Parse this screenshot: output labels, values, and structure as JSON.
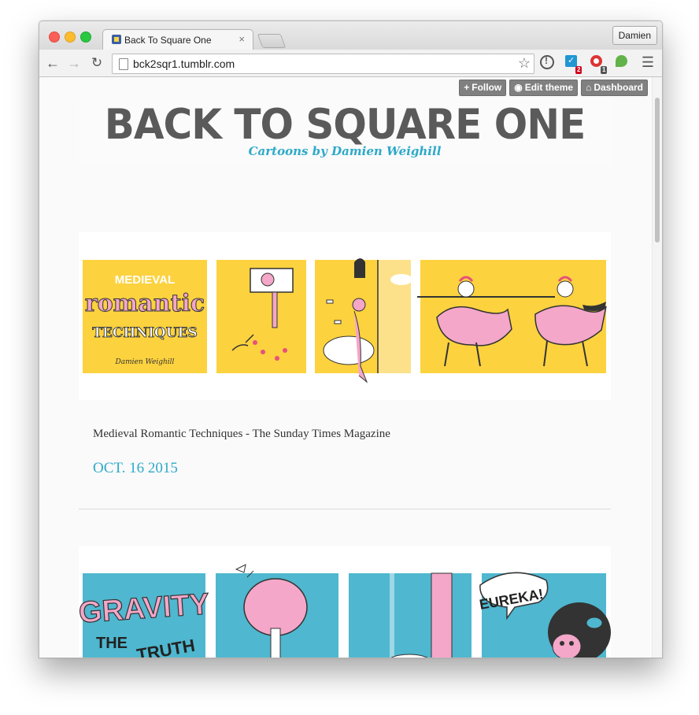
{
  "browser": {
    "tab_title": "Back To Square One",
    "tab_close": "×",
    "profile_name": "Damien",
    "url": "bck2sqr1.tumblr.com",
    "nav": {
      "back": "←",
      "forward": "→",
      "reload": "↻"
    },
    "star_icon": "☆",
    "menu_icon": "☰",
    "extensions": [
      {
        "name": "onepassword-icon"
      },
      {
        "name": "todo-icon",
        "badge": "2"
      },
      {
        "name": "adblock-icon",
        "badge": "1"
      },
      {
        "name": "evernote-icon"
      }
    ]
  },
  "tumblr_controls": {
    "follow": "Follow",
    "follow_icon": "+",
    "edit_theme": "Edit theme",
    "edit_icon": "◉",
    "dashboard": "Dashboard",
    "dashboard_icon": "⌂"
  },
  "blog": {
    "title": "BACK TO SQUARE ONE",
    "subtitle": "Cartoons by Damien Weighill"
  },
  "posts": [
    {
      "panels": [
        {
          "lines": [
            "MEDIEVAL",
            "romantic",
            "TECHNIQUES",
            "Damien Weighill"
          ]
        }
      ],
      "caption": "Medieval Romantic Techniques - The Sunday Times Magazine",
      "date": "OCT. 16 2015"
    },
    {
      "panels": [
        {
          "lines": [
            "GRAVITY",
            "THE",
            "TRUTH"
          ]
        },
        {
          "lines": [
            "EUREKA!"
          ]
        }
      ]
    }
  ],
  "colors": {
    "accent": "#2ea9c9",
    "panel_yellow": "#fcd23f",
    "panel_blue": "#4fb7cf",
    "pink": "#f4a7c8"
  }
}
